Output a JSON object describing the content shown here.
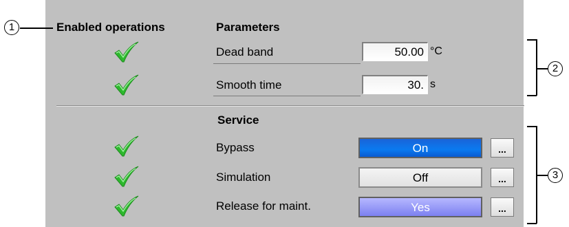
{
  "callouts": {
    "c1": "1",
    "c2": "2",
    "c3": "3"
  },
  "headers": {
    "enabled_operations": "Enabled operations",
    "parameters": "Parameters",
    "service": "Service"
  },
  "parameters": [
    {
      "label": "Dead band",
      "value": "50.00",
      "unit": "°C",
      "enabled": true
    },
    {
      "label": "Smooth time",
      "value": "30.",
      "unit": "s",
      "enabled": true
    }
  ],
  "service": [
    {
      "label": "Bypass",
      "state": "On",
      "state_color": "#0a6ee8",
      "more": "...",
      "enabled": true
    },
    {
      "label": "Simulation",
      "state": "Off",
      "state_color": "#e8e8e8",
      "more": "...",
      "enabled": true
    },
    {
      "label": "Release for maint.",
      "state": "Yes",
      "state_color": "#8a8eff",
      "more": "...",
      "enabled": true
    }
  ],
  "icons": {
    "enabled": "green-checkmark-icon"
  },
  "colors": {
    "panel_bg": "#c0c0c0",
    "check_green": "#2db82d"
  }
}
